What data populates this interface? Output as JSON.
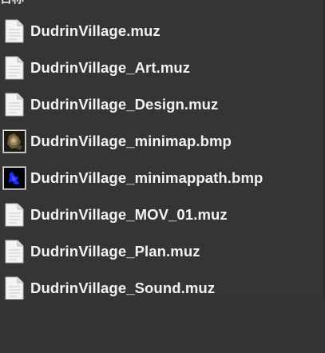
{
  "header": {
    "partial_label": "日称"
  },
  "files": [
    {
      "name": "DudrinVillage.muz",
      "icon": "document-icon"
    },
    {
      "name": "DudrinVillage_Art.muz",
      "icon": "document-icon"
    },
    {
      "name": "DudrinVillage_Design.muz",
      "icon": "document-icon"
    },
    {
      "name": "DudrinVillage_minimap.bmp",
      "icon": "minimap-thumbnail-icon"
    },
    {
      "name": "DudrinVillage_minimappath.bmp",
      "icon": "minimappath-thumbnail-icon"
    },
    {
      "name": "DudrinVillage_MOV_01.muz",
      "icon": "document-icon"
    },
    {
      "name": "DudrinVillage_Plan.muz",
      "icon": "document-icon"
    },
    {
      "name": "DudrinVillage_Sound.muz",
      "icon": "document-icon"
    }
  ],
  "colors": {
    "background": "#353535",
    "text": "#f2f2f2"
  }
}
